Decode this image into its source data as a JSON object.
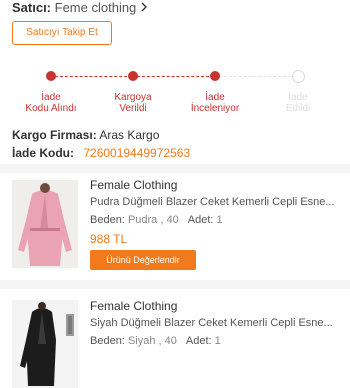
{
  "seller": {
    "label": "Satıcı:",
    "name": "Feme clothing",
    "chevron": "chevron-right-icon"
  },
  "follow_button": "Satıcıyı Takip Et",
  "tracking": {
    "steps": [
      {
        "label": "İade\nKodu Alındı",
        "active": true
      },
      {
        "label": "Kargoya\nVerildi",
        "active": true
      },
      {
        "label": "İade\nİnceleniyor",
        "active": true
      },
      {
        "label": "İade\nEdildi",
        "active": false
      }
    ],
    "active_color": "#c8332f",
    "inactive_color": "#dedede"
  },
  "cargo": {
    "label": "Kargo Firması:",
    "value": "Aras Kargo"
  },
  "return_code": {
    "label": "İade Kodu:",
    "value": "7260019449972563"
  },
  "products": [
    {
      "brand": "Female Clothing",
      "name": "Pudra Düğmeli Blazer Ceket Kemerli Cepli Esne...",
      "size_label": "Beden:",
      "size_value": "Pudra , 40",
      "qty_label": "Adet:",
      "qty_value": "1",
      "price": "988 TL",
      "rate_button": "Ürünü Değerlendir"
    },
    {
      "brand": "Female Clothing",
      "name": "Siyah Düğmeli Blazer Ceket Kemerli Cepli Esne...",
      "size_label": "Beden:",
      "size_value": "Siyah , 40",
      "qty_label": "Adet:",
      "qty_value": "1"
    }
  ],
  "colors": {
    "accent": "#f27a1a",
    "status_red": "#c8332f"
  }
}
